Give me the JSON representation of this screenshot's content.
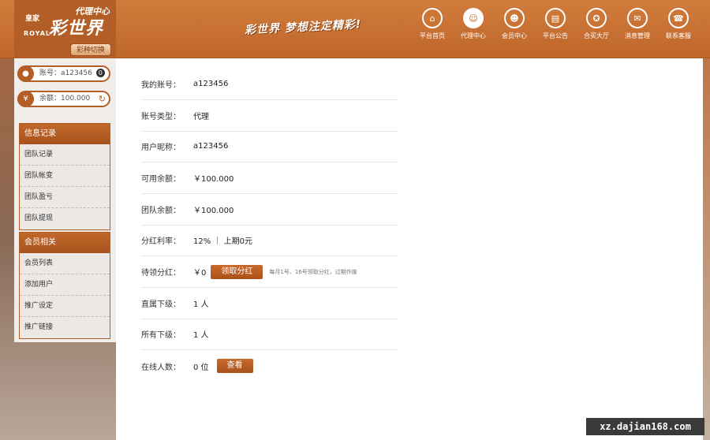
{
  "header": {
    "logo_brand_small": "皇家",
    "logo_brand_main": "彩世界",
    "logo_royal": "ROYAL",
    "logo_tag": "代理中心",
    "switch_label": "彩种切换",
    "slogan": "彩世界 梦想注定精彩!",
    "nav": [
      {
        "label": "平台首页",
        "icon": "home-icon",
        "glyph": "⌂"
      },
      {
        "label": "代理中心",
        "icon": "agent-icon",
        "glyph": "☺"
      },
      {
        "label": "会员中心",
        "icon": "user-icon",
        "glyph": "☻"
      },
      {
        "label": "平台公告",
        "icon": "notice-icon",
        "glyph": "▤"
      },
      {
        "label": "合买大厅",
        "icon": "group-buy-icon",
        "glyph": "✪"
      },
      {
        "label": "消息管理",
        "icon": "message-icon",
        "glyph": "✉"
      },
      {
        "label": "联系客服",
        "icon": "support-icon",
        "glyph": "☎"
      }
    ]
  },
  "sidebar": {
    "account_label": "账号：",
    "account_value": "a123456",
    "account_badge": "0",
    "balance_label": "余额：",
    "balance_value": "100.000",
    "groups": [
      {
        "title": "信息记录",
        "items": [
          "团队记录",
          "团队帐变",
          "团队盈亏",
          "团队提现"
        ]
      },
      {
        "title": "会员相关",
        "items": [
          "会员列表",
          "添加用户",
          "推广设定",
          "推广链接"
        ]
      }
    ]
  },
  "main": {
    "rows": [
      {
        "label": "我的账号：",
        "value": "a123456"
      },
      {
        "label": "账号类型：",
        "value": "代理"
      },
      {
        "label": "用户昵称：",
        "value": "a123456"
      },
      {
        "label": "可用余额：",
        "value": "￥100.000"
      },
      {
        "label": "团队余额：",
        "value": "￥100.000"
      },
      {
        "label": "分红利率：",
        "value": "12% ｜ 上期0元"
      },
      {
        "label": "待领分红：",
        "value": "￥0",
        "button": "领取分红",
        "hint": "每月1号、16号领取分红，过期作废"
      },
      {
        "label": "直属下级：",
        "value": "1 人"
      },
      {
        "label": "所有下级：",
        "value": "1 人"
      },
      {
        "label": "在线人数：",
        "value": "0 位",
        "button": "查看"
      }
    ]
  },
  "watermark": "xz.dajian168.com",
  "colors": {
    "brand": "#c0672b",
    "brand_dark": "#a8531d"
  }
}
